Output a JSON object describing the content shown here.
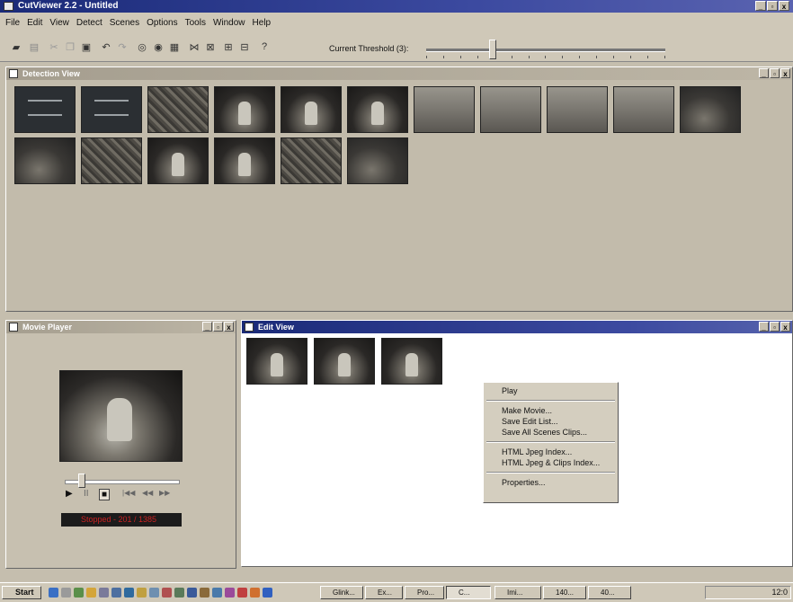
{
  "app": {
    "title": "CutViewer 2.2 - Untitled"
  },
  "menu": [
    "File",
    "Edit",
    "View",
    "Detect",
    "Scenes",
    "Options",
    "Tools",
    "Window",
    "Help"
  ],
  "toolbar": {
    "threshold_label": "Current Threshold (3):",
    "threshold_fraction": 0.28
  },
  "detection_view": {
    "title": "Detection View",
    "frame_count": 17
  },
  "movie_player": {
    "title": "Movie Player",
    "status": "Stopped - 201 / 1385",
    "position_fraction": 0.15,
    "controls": [
      "▶",
      "II",
      "■",
      "|◀◀",
      "◀◀",
      "▶▶"
    ]
  },
  "edit_view": {
    "title": "Edit View",
    "clip_count": 3
  },
  "context_menu": {
    "groups": [
      [
        "Play"
      ],
      [
        "Make Movie...",
        "Save Edit List...",
        "Save All Scenes Clips..."
      ],
      [
        "HTML Jpeg Index...",
        "HTML Jpeg & Clips Index..."
      ],
      [
        "Properties..."
      ]
    ]
  },
  "taskbar": {
    "start_label": "Start",
    "tasks": [
      "Glink...",
      "Ex...",
      "Pro...",
      "C...",
      "Imi...",
      "140...",
      "40..."
    ],
    "clock": "12:0"
  },
  "colors": {
    "title_active": "#1a2a78",
    "title_inactive": "#a59e8f",
    "status_text": "#cc2222"
  }
}
